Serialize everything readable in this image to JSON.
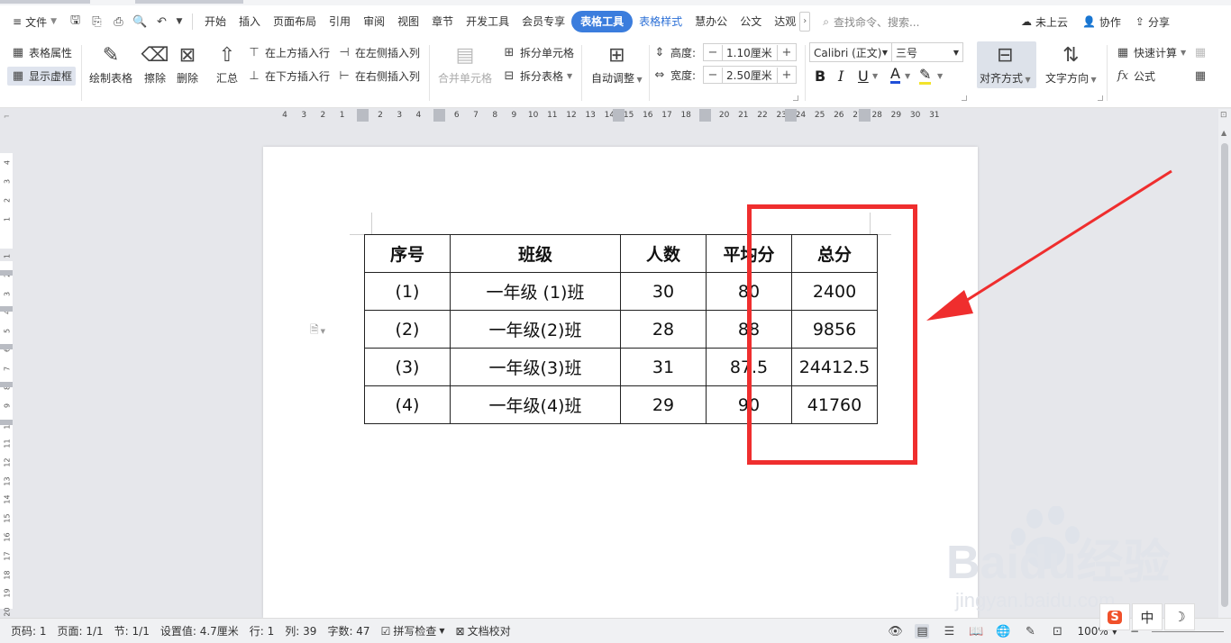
{
  "menubar": {
    "file_label": "文件",
    "tabs": [
      "开始",
      "插入",
      "页面布局",
      "引用",
      "审阅",
      "视图",
      "章节",
      "开发工具",
      "会员专享"
    ],
    "active_tab": "表格工具",
    "tab_table_style": "表格样式",
    "tabs_after": [
      "慧办公",
      "公文",
      "达观"
    ],
    "search_placeholder": "查找命令、搜索...",
    "cloud": "未上云",
    "collab": "协作",
    "share": "分享"
  },
  "ribbon": {
    "table_props": "表格属性",
    "show_gridlines": "显示虚框",
    "draw_table": "绘制表格",
    "erase": "擦除",
    "delete": "删除",
    "summary": "汇总",
    "insert_row_above": "在上方插入行",
    "insert_row_below": "在下方插入行",
    "insert_col_left": "在左侧插入列",
    "insert_col_right": "在右侧插入列",
    "merge_cells": "合并单元格",
    "split_cells": "拆分单元格",
    "split_table": "拆分表格",
    "auto_fit": "自动调整",
    "height_label": "高度:",
    "height_value": "1.10厘米",
    "width_label": "宽度:",
    "width_value": "2.50厘米",
    "font_name": "Calibri (正文)",
    "font_size": "三号",
    "bold": "B",
    "italic": "I",
    "underline": "U",
    "font_color": "A",
    "align": "对齐方式",
    "text_direction": "文字方向",
    "quick_calc": "快速计算",
    "formula": "公式",
    "fx": "fx"
  },
  "ruler": {
    "ticks": [
      "4",
      "3",
      "2",
      "1",
      "1",
      "2",
      "3",
      "4",
      "5",
      "6",
      "7",
      "8",
      "9",
      "10",
      "11",
      "12",
      "13",
      "14",
      "15",
      "16",
      "17",
      "18",
      "19",
      "20",
      "21",
      "22",
      "23",
      "24",
      "25",
      "26",
      "27",
      "28",
      "29",
      "30",
      "31"
    ],
    "vticks": [
      "4",
      "3",
      "2",
      "1",
      "1",
      "2",
      "3",
      "4",
      "5",
      "6",
      "7",
      "8",
      "9",
      "10",
      "11",
      "12",
      "13",
      "14",
      "15",
      "16",
      "17",
      "18",
      "19",
      "20"
    ]
  },
  "table": {
    "headers": [
      "序号",
      "班级",
      "人数",
      "平均分",
      "总分"
    ],
    "rows": [
      [
        "(1)",
        "一年级 (1)班",
        "30",
        "80",
        "2400"
      ],
      [
        "(2)",
        "一年级(2)班",
        "28",
        "88",
        "9856"
      ],
      [
        "(3)",
        "一年级(3)班",
        "31",
        "87.5",
        "24412.5"
      ],
      [
        "(4)",
        "一年级(4)班",
        "29",
        "90",
        "41760"
      ]
    ]
  },
  "status": {
    "page_code": "页码: 1",
    "pages": "页面: 1/1",
    "section": "节: 1/1",
    "setting": "设置值: 4.7厘米",
    "row": "行: 1",
    "col": "列: 39",
    "word_count": "字数: 47",
    "spell_check": "拼写检查",
    "doc_check": "文档校对",
    "zoom": "100%"
  },
  "ime": {
    "logo": "S",
    "mode": "中"
  },
  "watermark": {
    "brand_text": "Baidu经验",
    "url": "jingyan.baidu.com"
  },
  "colors": {
    "accent": "#3b7ddd",
    "highlight": "#ef2e2e"
  }
}
